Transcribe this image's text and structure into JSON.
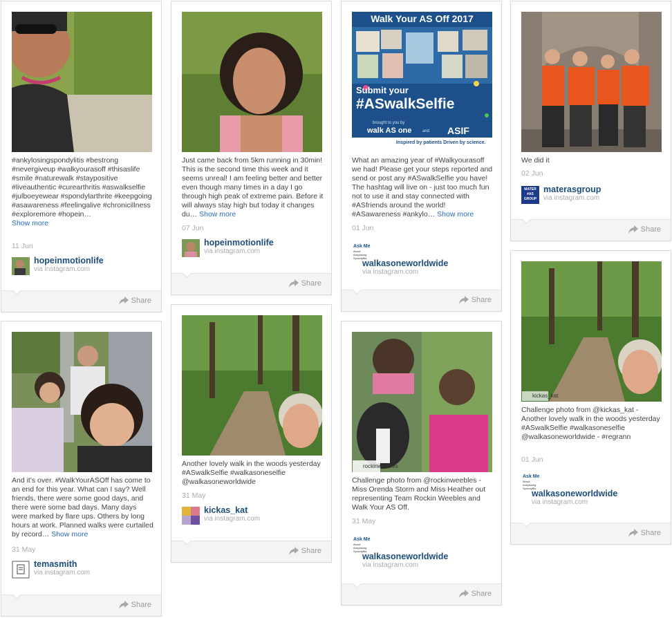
{
  "share_label": "Share",
  "show_more_label": "Show more",
  "cards": [
    {
      "caption": "#ankylosingspondylitis #bestrong #nevergiveup #walkyourasoff #thisaslife #smile #naturewalk #staypositive #liveauthentic #curearthritis #aswalkselfie #julboeyewear #spondylarthrite #keepgoing #asawareness #feelingalive #chronicillness #exploremore #hopein…",
      "show_more": "Show more",
      "date": "11 Jun",
      "username": "hopeinmotionlife",
      "via": "via instagram.com"
    },
    {
      "caption": "Just came back from 5km running in 30min! This is the second time this week and it seems unreal! I am feeling better and better even though many times in a day I go through high peak of extreme pain. Before it will always stay high but today it changes du…",
      "show_more": "Show more",
      "date": "07 Jun",
      "username": "hopeinmotionlife",
      "via": "via instagram.com"
    },
    {
      "poster": {
        "title": "Walk Your AS Off 2017",
        "hashtag_line1": "Submit your",
        "hashtag_line2": "#ASwalkSelfie",
        "brought_by": "brought to you by",
        "brand1": "walk AS one",
        "and": "and",
        "brand2": "ASIF",
        "tagline": "Inspired by patients Driven by science."
      },
      "caption": "What an amazing year of #Walkyourasoff we had! Please get your steps reported and send or post any #ASwalkSelfie you have! The hashtag will live on - just too much fun not to use it and stay connected with #ASfriends around the world! #ASawareness #ankylo…",
      "show_more": "Show more",
      "date": "01 Jun",
      "username": "walkasoneworldwide",
      "via": "via instagram.com"
    },
    {
      "caption": "We did it",
      "date": "02 Jun",
      "username": "materasgroup",
      "via": "via instagram.com",
      "avatar_text": "MATER #AS GROUP"
    },
    {
      "caption": "And it's over. #WalkYourASOff has come to an end for this year. What can I say? Well friends, there were some good days, and there were some bad days. Many days were marked by flare ups. Others by long hours at work. Planned walks were curtailed by record…",
      "show_more": "Show more",
      "date": "31 May",
      "username": "temasmith",
      "via": "via instagram.com"
    },
    {
      "caption": "Another lovely walk in the woods yesterday #ASwalkSelfie #walkasoneselfie @walkasoneworldwide",
      "date": "31 May",
      "username": "kickas_kat",
      "via": "via instagram.com"
    },
    {
      "photo_tag": "rockinweebles",
      "caption": "Challenge photo from @rockinweebles - Miss Orenda Storm and Miss Heather out representing Team Rockin Weebles and Walk Your AS Off.",
      "date": "31 May",
      "username": "walkasoneworldwide",
      "via": "via instagram.com"
    },
    {
      "photo_tag": "kickas_kat",
      "caption": "Challenge photo from @kickas_kat - Another lovely walk in the woods yesterday #ASwalkSelfie #walkasoneselfie @walkasoneworldwide - #regrann",
      "date": "01 Jun",
      "username": "walkasoneworldwide",
      "via": "via instagram.com"
    }
  ],
  "avatar_logo_text": "Ask Me About Ankylosing Spondylitis",
  "colors": {
    "username": "#1d4d7a",
    "show_more": "#2a6ab3",
    "footer_bg": "#f4f4f4",
    "poster_bg": "#1d4f8a"
  }
}
